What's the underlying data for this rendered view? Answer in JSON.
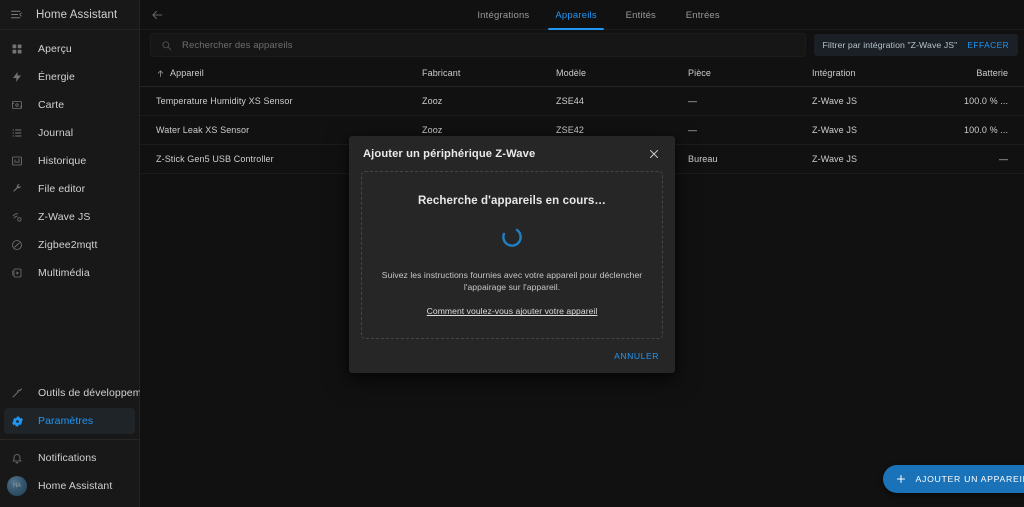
{
  "colors": {
    "accent": "#2196f3",
    "fab_bg": "#1a72b8",
    "sidebar_bg": "#181818",
    "page_bg": "#111111",
    "dialog_bg": "#262626"
  },
  "sidebar": {
    "title": "Home Assistant",
    "menu_icon": "hamburger-menu-icon",
    "items": [
      {
        "label": "Aperçu",
        "icon": "grid-icon",
        "active": false
      },
      {
        "label": "Énergie",
        "icon": "lightning-icon",
        "active": false
      },
      {
        "label": "Carte",
        "icon": "map-icon",
        "active": false
      },
      {
        "label": "Journal",
        "icon": "list-icon",
        "active": false
      },
      {
        "label": "Historique",
        "icon": "chart-icon",
        "active": false
      },
      {
        "label": "File editor",
        "icon": "wrench-icon",
        "active": false
      },
      {
        "label": "Z-Wave JS",
        "icon": "zwave-icon",
        "active": false
      },
      {
        "label": "Zigbee2mqtt",
        "icon": "zigbee-icon",
        "active": false
      },
      {
        "label": "Multimédia",
        "icon": "media-icon",
        "active": false
      }
    ],
    "bottom_items": [
      {
        "label": "Outils de développement",
        "icon": "hammer-icon",
        "active": false
      },
      {
        "label": "Paramètres",
        "icon": "gear-icon",
        "active": true
      }
    ],
    "footer_items": [
      {
        "label": "Notifications",
        "icon": "bell-icon",
        "active": false
      },
      {
        "label": "Home Assistant",
        "icon": "avatar",
        "active": false
      }
    ],
    "avatar_initials": "HA"
  },
  "toolbar": {
    "back_icon": "arrow-left-icon",
    "tabs": [
      {
        "label": "Intégrations",
        "active": false
      },
      {
        "label": "Appareils",
        "active": true
      },
      {
        "label": "Entités",
        "active": false
      },
      {
        "label": "Entrées",
        "active": false
      }
    ]
  },
  "search": {
    "icon": "search-icon",
    "placeholder": "Rechercher des appareils",
    "value": ""
  },
  "filter": {
    "chip_label": "Filtrer par intégration \"Z-Wave JS\"",
    "clear_label": "EFFACER",
    "filter_icon": "filter-icon"
  },
  "table": {
    "sort_indicator": "arrow-up-icon",
    "columns": [
      "Appareil",
      "Fabricant",
      "Modèle",
      "Pièce",
      "Intégration",
      "Batterie"
    ],
    "rows": [
      {
        "device": "Temperature Humidity XS Sensor",
        "maker": "Zooz",
        "model": "ZSE44",
        "room": "—",
        "integration": "Z-Wave JS",
        "battery": "100.0 % ...",
        "overflow": "—"
      },
      {
        "device": "Water Leak XS Sensor",
        "maker": "Zooz",
        "model": "ZSE42",
        "room": "—",
        "integration": "Z-Wave JS",
        "battery": "100.0 % ...",
        "overflow": "—"
      },
      {
        "device": "Z-Stick Gen5 USB Controller",
        "maker": "",
        "model": "",
        "room": "Bureau",
        "integration": "Z-Wave JS",
        "battery": "—",
        "overflow": "—"
      }
    ]
  },
  "dialog": {
    "title": "Ajouter un périphérique Z-Wave",
    "close_icon": "close-icon",
    "searching_title": "Recherche d'appareils en cours…",
    "spinner_icon": "loading-spinner-icon",
    "hint": "Suivez les instructions fournies avec votre appareil pour déclencher l'appairage sur l'appareil.",
    "link": "Comment voulez-vous ajouter votre appareil",
    "cancel_label": "ANNULER"
  },
  "fab": {
    "icon": "plus-icon",
    "label": "AJOUTER UN APPAREIL"
  }
}
